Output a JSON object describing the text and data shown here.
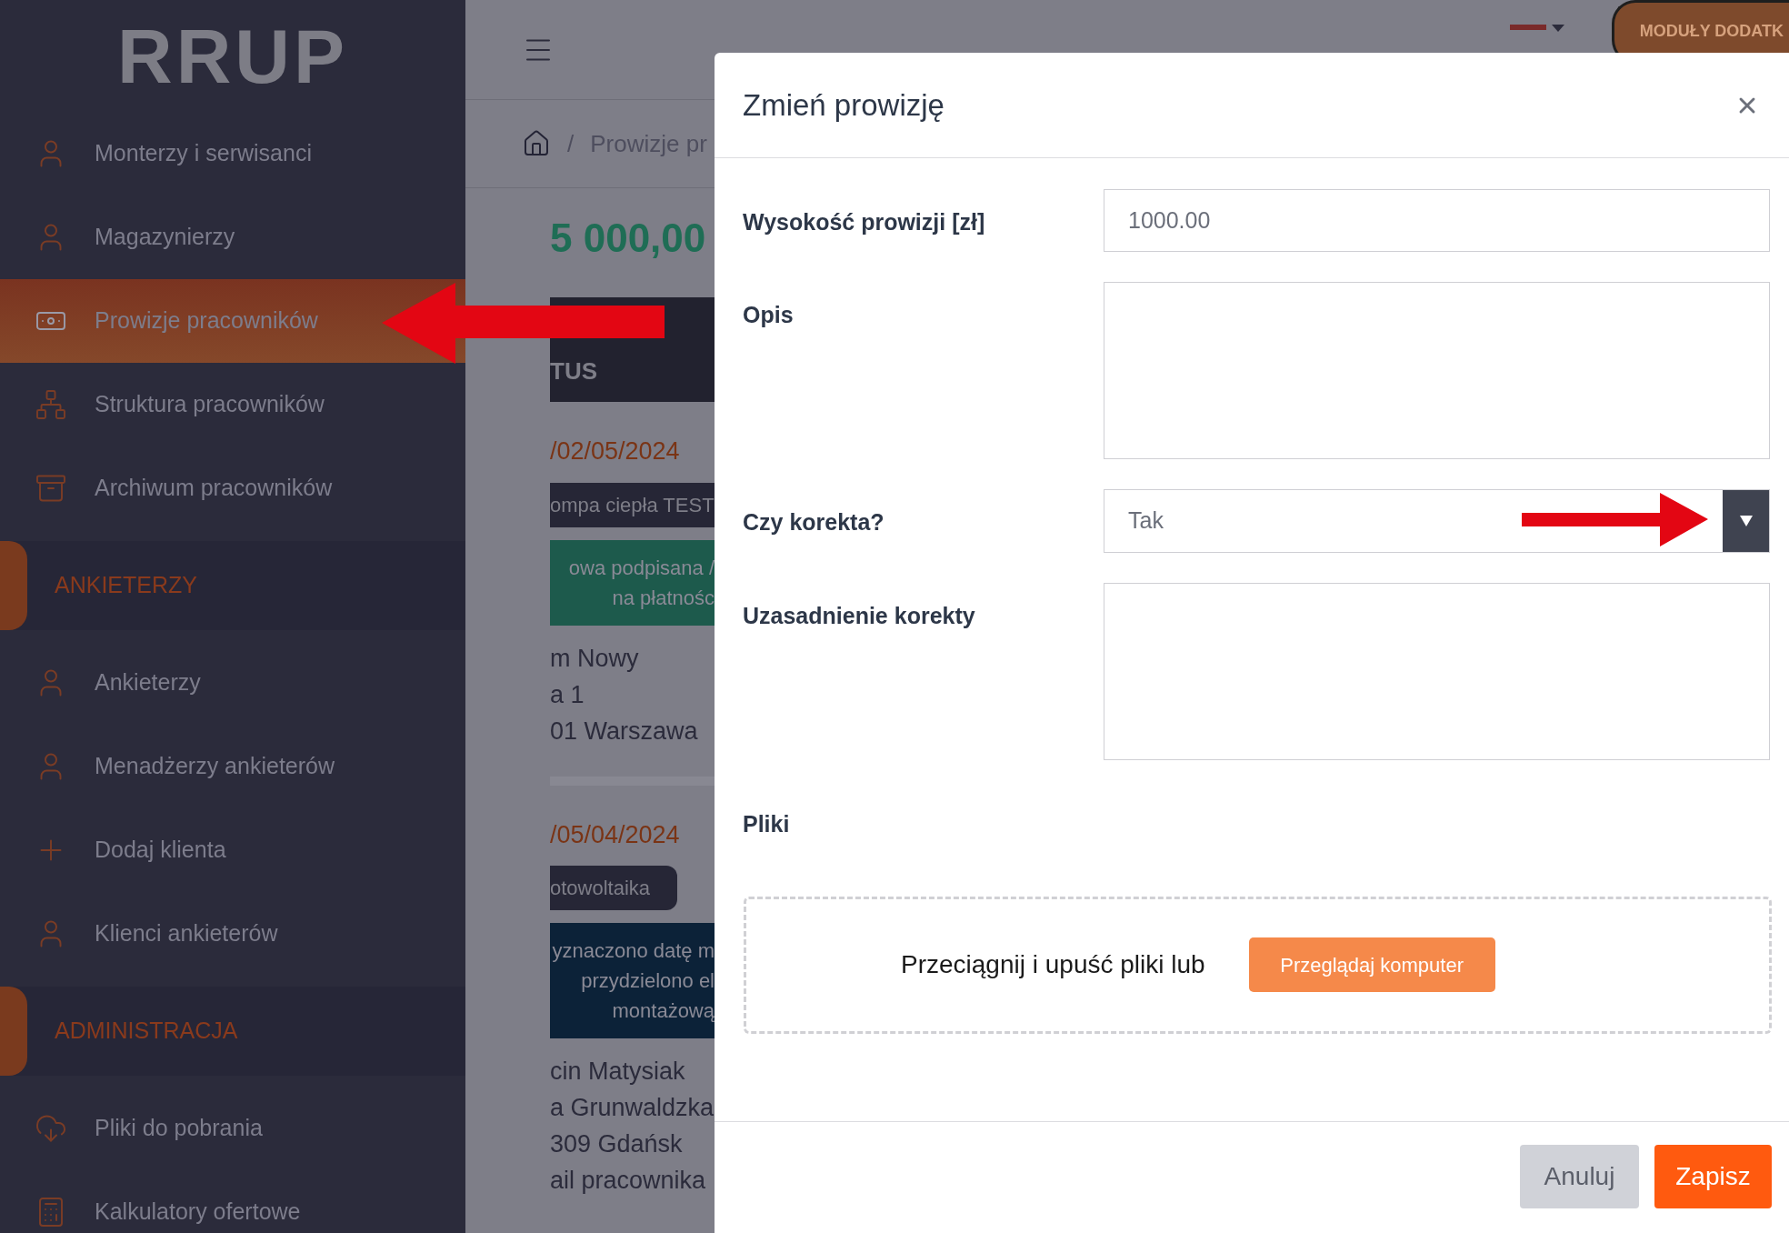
{
  "logo": "RRUP",
  "sidebar": [
    {
      "kind": "item",
      "label": "Monterzy i serwisanci",
      "selected": false
    },
    {
      "kind": "item",
      "label": "Magazynierzy",
      "selected": false
    },
    {
      "kind": "item",
      "label": "Prowizje pracowników",
      "selected": true
    },
    {
      "kind": "item",
      "label": "Struktura pracowników",
      "selected": false
    },
    {
      "kind": "item",
      "label": "Archiwum pracowników",
      "selected": false
    },
    {
      "kind": "section",
      "label": "ANKIETERZY"
    },
    {
      "kind": "item",
      "label": "Ankieterzy",
      "selected": false
    },
    {
      "kind": "item",
      "label": "Menadżerzy ankieterów",
      "selected": false
    },
    {
      "kind": "item",
      "label": "Dodaj klienta",
      "selected": false
    },
    {
      "kind": "item",
      "label": "Klienci ankieterów",
      "selected": false
    },
    {
      "kind": "section",
      "label": "ADMINISTRACJA"
    },
    {
      "kind": "item",
      "label": "Pliki do pobrania",
      "selected": false
    },
    {
      "kind": "item",
      "label": "Kalkulatory ofertowe",
      "selected": false
    }
  ],
  "header": {
    "modules_button": "MODUŁY DODATK"
  },
  "breadcrumb": {
    "separator": "/",
    "current": "Prowizje pr"
  },
  "total": "5 000,00",
  "table_header": "TUS",
  "cards": [
    {
      "date": "/02/05/2024",
      "product": "ompa ciepła TEST",
      "status": {
        "lines": [
          "owa podpisana /",
          "na płatnośc"
        ],
        "color": "#1d5a4c"
      },
      "address": [
        "m Nowy",
        "a 1",
        "01 Warszawa"
      ]
    },
    {
      "date": "/05/04/2024",
      "product": "otowoltaika",
      "status": {
        "lines": [
          "yznaczono datę m",
          "przydzielono el",
          "montażową"
        ],
        "color": "#0c2238"
      },
      "address": [
        "cin Matysiak",
        "a Grunwaldzka",
        "309 Gdańsk",
        "ail pracownika"
      ]
    }
  ],
  "modal": {
    "title": "Zmień prowizję",
    "fields": [
      {
        "kind": "input",
        "label": "Wysokość prowizji [zł]",
        "value": "1000.00"
      },
      {
        "kind": "textarea",
        "label": "Opis"
      },
      {
        "kind": "select",
        "label": "Czy korekta?",
        "value": "Tak"
      },
      {
        "kind": "textarea",
        "label": "Uzasadnienie korekty"
      }
    ],
    "files_label": "Pliki",
    "dropzone_text": "Przeciągnij i upuść pliki lub",
    "browse_button": "Przeglądaj komputer",
    "buttons": [
      {
        "kind": "secondary",
        "label": "Anuluj"
      },
      {
        "kind": "primary",
        "label": "Zapisz"
      }
    ]
  }
}
